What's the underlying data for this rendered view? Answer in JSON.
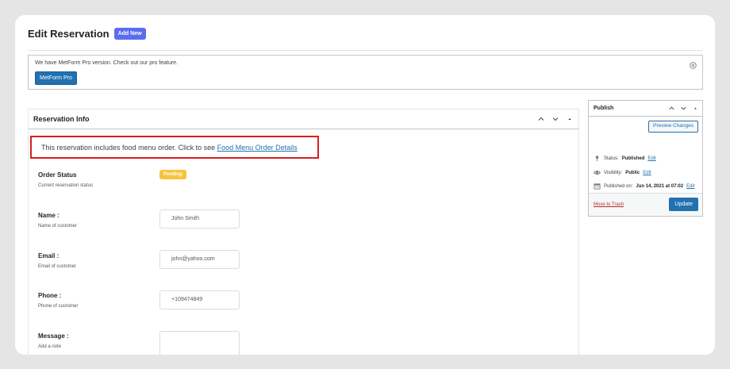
{
  "page": {
    "title": "Edit Reservation",
    "add_new_label": "Add New"
  },
  "notice": {
    "text": "We have MetForm Pro version. Check out our pro feature.",
    "button_label": "MetForm Pro",
    "close_icon": "close-circle-icon"
  },
  "reservation": {
    "title": "Reservation Info",
    "controls": [
      "chevron-up-icon",
      "chevron-down-icon",
      "triangle-up-icon"
    ],
    "menu_notice": {
      "text": "This reservation includes food menu order. Click to see ",
      "link_label": "Food Menu Order Details"
    },
    "order_status": {
      "label": "Order Status",
      "description": "Current reservation status",
      "badge": "Pending"
    },
    "fields": [
      {
        "label": "Name :",
        "description": "Name of customer",
        "value": "John Smith"
      },
      {
        "label": "Email :",
        "description": "Email of customer",
        "value": "john@yahoo.com"
      },
      {
        "label": "Phone :",
        "description": "Phone of customer",
        "value": "+109474849"
      },
      {
        "label": "Message :",
        "description": "Add a note",
        "value": ""
      }
    ]
  },
  "publish": {
    "title": "Publish",
    "preview_label": "Preview Changes",
    "status": {
      "prefix": "Status: ",
      "value": "Published",
      "edit": "Edit"
    },
    "visibility": {
      "prefix": "Visibility: ",
      "value": "Public",
      "edit": "Edit"
    },
    "published_on": {
      "prefix": "Published on: ",
      "value": "Jun 14, 2021 at 07:02",
      "edit": "Edit"
    },
    "trash_label": "Move to Trash",
    "update_label": "Update"
  },
  "colors": {
    "accent": "#2271b1",
    "add_new": "#5b6cf0",
    "highlight_border": "#d62020",
    "pending_badge": "#f6c33b",
    "trash": "#b32d2e"
  }
}
